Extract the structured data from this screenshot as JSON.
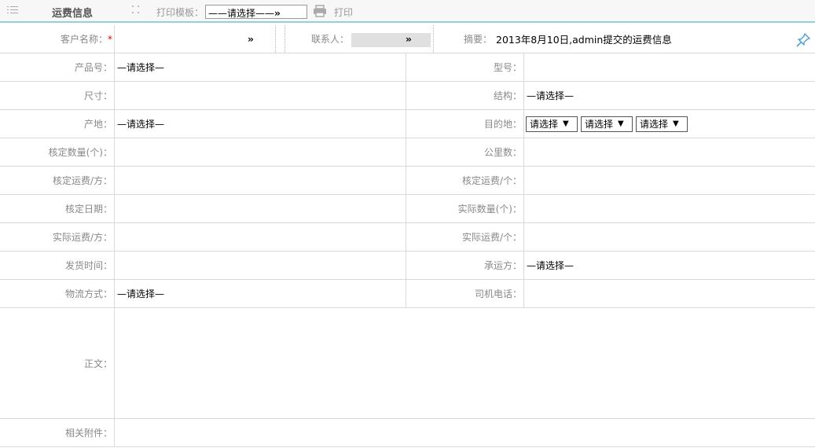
{
  "toolbar": {
    "title": "运费信息",
    "print_template_label": "打印模板：",
    "print_template_value": "——请选择——",
    "print_template_arrows": "››",
    "print_label": "打印"
  },
  "row1": {
    "customer_label": "客户名称：",
    "required_mark": "*",
    "customer_arrows": "››",
    "contact_label": "联系人：",
    "contact_arrows": "››",
    "summary_label": "摘要：",
    "summary_value": "2013年8月10日,admin提交的运费信息"
  },
  "fields": {
    "product_no_label": "产品号：",
    "product_no_value": "—请选择—",
    "model_label": "型号：",
    "size_label": "尺寸：",
    "structure_label": "结构：",
    "structure_value": "—请选择—",
    "origin_label": "产地：",
    "origin_value": "—请选择—",
    "destination_label": "目的地：",
    "destination_selects": [
      "请选择",
      "请选择",
      "请选择"
    ],
    "approved_qty_label": "核定数量(个)：",
    "km_label": "公里数：",
    "approved_freight_m3_label": "核定运费/方：",
    "approved_freight_unit_label": "核定运费/个：",
    "approved_date_label": "核定日期：",
    "actual_qty_label": "实际数量(个)：",
    "actual_freight_m3_label": "实际运费/方：",
    "actual_freight_unit_label": "实际运费/个：",
    "ship_time_label": "发货时间：",
    "carrier_label": "承运方：",
    "carrier_value": "—请选择—",
    "logistics_label": "物流方式：",
    "logistics_value": "—请选择—",
    "driver_phone_label": "司机电话：",
    "body_label": "正文：",
    "attachments_label": "相关附件："
  },
  "icons": {
    "menu": "menu-icon",
    "grip": "grip-icon",
    "print": "printer-icon",
    "pin": "pin-icon"
  },
  "colors": {
    "accent_line": "#8fd3dc",
    "required": "#dd0000",
    "pin": "#4a9fd8"
  }
}
